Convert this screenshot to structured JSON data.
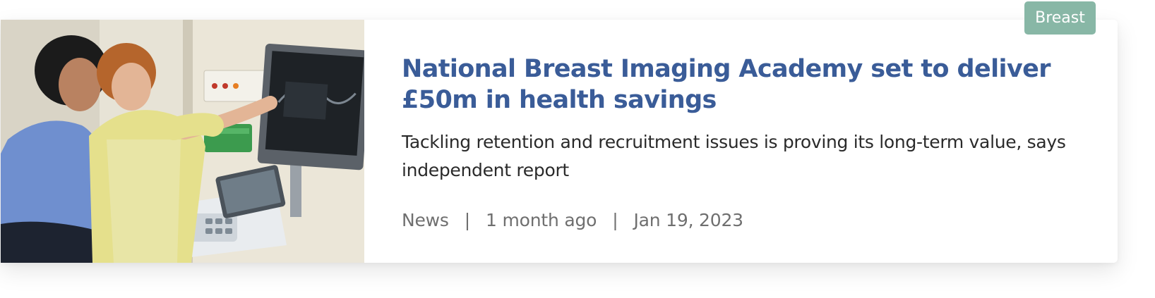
{
  "article": {
    "category_tag": "Breast",
    "title": "National Breast Imaging Academy set to deliver £50m in health savings",
    "summary": "Tackling retention and recruitment issues is proving its long-term value, says independent report",
    "meta": {
      "type": "News",
      "separator": "|",
      "relative_time": "1 month ago",
      "date": "Jan 19, 2023"
    },
    "image": {
      "icon": "photo-thumbnail"
    }
  },
  "colors": {
    "title": "#3a5c98",
    "tag_bg": "#88b7a6",
    "meta": "#6f6f6f",
    "summary": "#2a2a2a"
  }
}
